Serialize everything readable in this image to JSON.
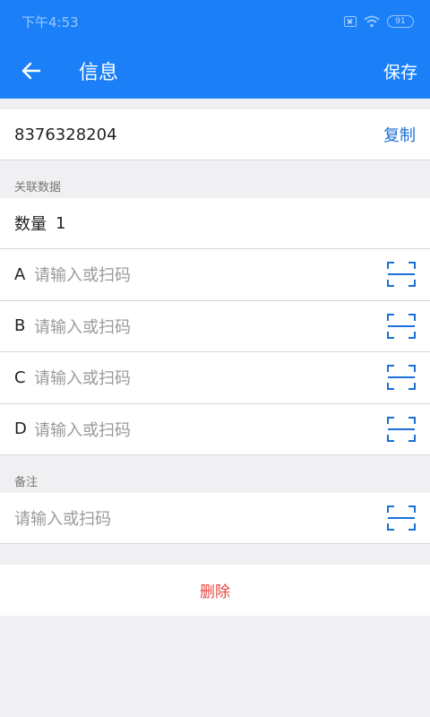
{
  "status_bar": {
    "time": "下午4:53",
    "battery": "91"
  },
  "app_bar": {
    "title": "信息",
    "save_label": "保存"
  },
  "code": {
    "value": "8376328204",
    "copy_label": "复制"
  },
  "related": {
    "section_title": "关联数据",
    "count_label": "数量",
    "count_value": "1",
    "fields": [
      {
        "letter": "A",
        "placeholder": "请输入或扫码"
      },
      {
        "letter": "B",
        "placeholder": "请输入或扫码"
      },
      {
        "letter": "C",
        "placeholder": "请输入或扫码"
      },
      {
        "letter": "D",
        "placeholder": "请输入或扫码"
      }
    ]
  },
  "remark": {
    "section_title": "备注",
    "placeholder": "请输入或扫码"
  },
  "delete_label": "删除",
  "colors": {
    "primary": "#1b80f8",
    "link": "#1b6fd6",
    "danger": "#e8453c"
  }
}
